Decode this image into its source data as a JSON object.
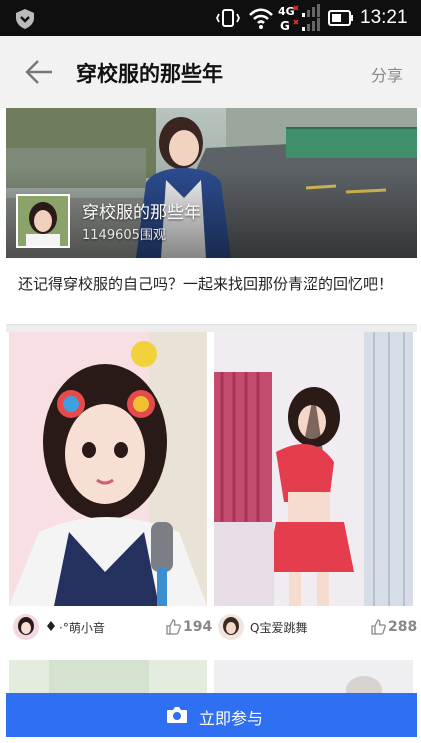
{
  "status_bar": {
    "time": "13:21",
    "network": "4G",
    "icons": [
      "shield-icon",
      "vibrate-icon",
      "wifi-icon",
      "signal-icon",
      "battery-icon"
    ]
  },
  "header": {
    "title": "穿校服的那些年",
    "share_label": "分享"
  },
  "topic": {
    "name": "穿校服的那些年",
    "views": "1149605围观",
    "description": "还记得穿校服的自己吗？一起来找回那份青涩的回忆吧！"
  },
  "feed": [
    {
      "user": "·°萌小音",
      "likes": "194"
    },
    {
      "user": "Q宝爱跳舞",
      "likes": "288"
    }
  ],
  "bottom_bar": {
    "join_label": "立即参与"
  },
  "colors": {
    "accent": "#2f6ff1",
    "header_bg": "#f2f2f2",
    "status_bar_bg": "#0f0f0f"
  }
}
